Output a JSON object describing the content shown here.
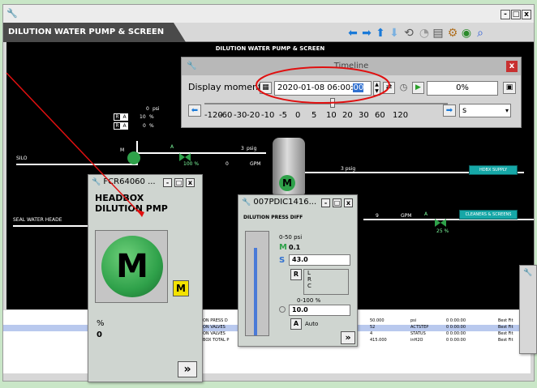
{
  "window": {
    "title": "DILUTION WATER PUMP & SCREEN",
    "min": "-",
    "max": "□",
    "close": "x"
  },
  "canvas": {
    "title": "DILUTION WATER PUMP & SCREEN",
    "silo": "SILO",
    "seal_water": "SEAL WATER HEADE",
    "psi0": "0",
    "psi0_u": "psi",
    "r1": "R",
    "a1": "A",
    "v10": "10",
    "pct1": "%",
    "r2": "R",
    "a2": "A",
    "v0": "0",
    "pct2": "%",
    "m_label": "M",
    "a_label": "A",
    "pct100": "100 %",
    "psig3": "3",
    "psig3_u": "psig",
    "zero": "0",
    "gpm": "GPM",
    "psig3b": "3 psig",
    "hdbx": "HDBX SUPPLY",
    "flow9": "9",
    "gpm9": "GPM",
    "a2lbl": "A",
    "cleaners": "CLEANERS & SCREENS",
    "pct25": "25 %",
    "tank_m": "M"
  },
  "timeline": {
    "title": "Timeline",
    "label": "Display moment:",
    "datetime": "2020-01-08 06:00:",
    "sec": "00",
    "percent": "0%",
    "ticks": [
      "-120",
      "-60",
      "-30",
      "-20",
      "-10",
      "-5",
      "0",
      "5",
      "10",
      "20",
      "30",
      "60",
      "120"
    ],
    "unit": "s"
  },
  "pump_panel": {
    "title": "FCR64060 ...",
    "name": "HEADBOX DILUTION PMP",
    "m": "M",
    "small_m": "M",
    "pct": "%",
    "value": "0",
    "more": "»"
  },
  "pdic_panel": {
    "title": "007PDIC1416...",
    "name": "DILUTION PRESS DIFF",
    "range1": "0-50 psi",
    "m": "M",
    "mval": "0.1",
    "s": "S",
    "sval": "43.0",
    "r": "R",
    "lrc": "L\nR\nC",
    "range2": "0-100 %",
    "oval": "10.0",
    "a": "A",
    "auto": "Auto",
    "more": "»"
  },
  "grid": {
    "rows": [
      {
        "desc": "ON PRESS D",
        "v1": "50.000",
        "u": "psi",
        "t": "0 0:00:00",
        "f": "Best Fit",
        "sel": false
      },
      {
        "desc": "ON VALVES",
        "v1": "52",
        "u": "ACTSTEP",
        "t": "0 0:00:00",
        "f": "Best Fit",
        "sel": true
      },
      {
        "desc": "ON VALVES",
        "v1": "4",
        "u": "STATUS",
        "t": "0 0:00:00",
        "f": "Best Fit",
        "sel": false
      },
      {
        "desc": "BOX TOTAL P",
        "v1": "415.000",
        "u": "inH2O",
        "t": "0 0:00:00",
        "f": "Best Fit",
        "sel": false
      }
    ]
  },
  "colors": {
    "accent": "#e01010",
    "pump_green": "#2fa14a",
    "bg": "#c9e6c7"
  }
}
